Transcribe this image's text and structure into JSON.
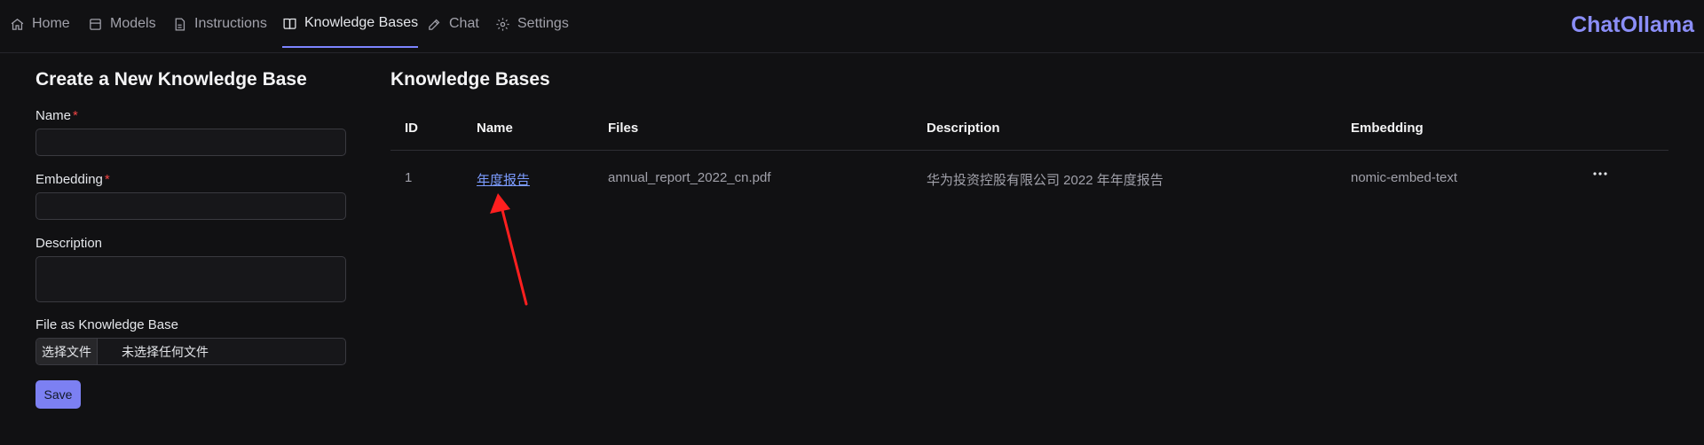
{
  "nav": {
    "items": [
      {
        "label": "Home",
        "icon": "home-icon"
      },
      {
        "label": "Models",
        "icon": "models-icon"
      },
      {
        "label": "Instructions",
        "icon": "document-icon"
      },
      {
        "label": "Knowledge Bases",
        "icon": "book-icon"
      },
      {
        "label": "Chat",
        "icon": "edit-icon"
      },
      {
        "label": "Settings",
        "icon": "gear-icon"
      }
    ],
    "active": "Knowledge Bases",
    "brand": "ChatOllama"
  },
  "form": {
    "title": "Create a New Knowledge Base",
    "name_label": "Name",
    "name_value": "",
    "embedding_label": "Embedding",
    "embedding_value": "",
    "description_label": "Description",
    "description_value": "",
    "file_label": "File as Knowledge Base",
    "file_button": "选择文件",
    "file_status": "未选择任何文件",
    "required_mark": "*",
    "save_label": "Save"
  },
  "table": {
    "title": "Knowledge Bases",
    "columns": [
      "ID",
      "Name",
      "Files",
      "Description",
      "Embedding"
    ],
    "rows": [
      {
        "id": "1",
        "name": "年度报告",
        "files": "annual_report_2022_cn.pdf",
        "description": "华为投资控股有限公司 2022 年年度报告",
        "embedding": "nomic-embed-text"
      }
    ],
    "more_icon": "more-horizontal-icon"
  },
  "colors": {
    "background": "#111113",
    "accent": "#7c80f2",
    "link": "#7c9cff",
    "annotation_arrow": "#ff1f1f"
  }
}
